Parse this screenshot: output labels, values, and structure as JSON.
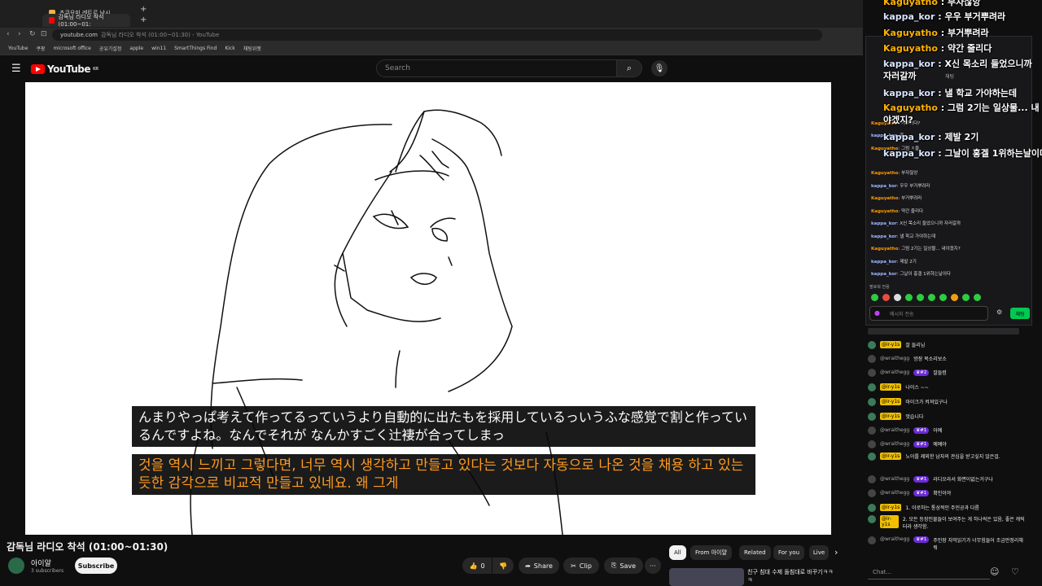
{
  "browser": {
    "tabs": [
      {
        "label": "츠쿠요미 레트로 낚시"
      },
      {
        "label": "감독님 라디오 착석 (01:00~01:"
      }
    ],
    "new_tab": "+",
    "url_domain": "youtube.com",
    "url_title": "감독님 라디오 착석 (01:00~01:30) - YouTube",
    "bookmarks": [
      "YouTube",
      "쿠팡",
      "microsoft office",
      "공유기설정",
      "apple",
      "win11",
      "SmartThings Find",
      "Kick",
      "채팅위젯"
    ]
  },
  "youtube": {
    "logo": "YouTube",
    "logo_region": "KR",
    "search_placeholder": "Search"
  },
  "video": {
    "subtitle_jp": "んまりやっぱ考えて作ってるっていうより自動的に出たもを採用しているっいうふな感覚で割と作っているんですよね。なんでそれが なんかすごく辻褄が合ってしまっ",
    "subtitle_ko": "것을 역시 느끼고 그렇다면, 너무 역시 생각하고 만들고 있다는 것보다 자동으로 나온 것을 채용 하고 있는 듯한 감각으로 비교적 만들고 있네요. 왜 그게"
  },
  "info": {
    "title": "감독님 라디오 착석 (01:00~01:30)",
    "channel": "아이얄",
    "subscribers": "3 subscribers",
    "subscribe": "Subscribe",
    "like_count": "0",
    "share": "Share",
    "clip": "Clip",
    "save": "Save",
    "more": "···"
  },
  "chips": [
    "All",
    "From 아이얄",
    "Related",
    "For you",
    "Live"
  ],
  "related": {
    "title": "친구 침대 수제 돌침대로 바꾸기ㅋㅋㅋ"
  },
  "overlay_chat": [
    {
      "user": "Kaguyatho",
      "text": "부자잖앙",
      "kind": "k"
    },
    {
      "user": "kappa_kor",
      "text": "우우 부거뿌려라",
      "kind": "b"
    },
    {
      "user": "Kaguyatho",
      "text": "부거뿌려라",
      "kind": "k"
    },
    {
      "user": "Kaguyatho",
      "text": "약간 줄리다",
      "kind": "k"
    },
    {
      "user": "kappa_kor",
      "text": "X신 목소리 들었으니까 자러갈까",
      "kind": "b"
    },
    {
      "user": "kappa_kor",
      "text": "낼 학교 가야하는데",
      "kind": "b"
    },
    {
      "user": "Kaguyatho",
      "text": "그럼 2기는 일상물... 내야겠지?",
      "kind": "k"
    },
    {
      "user": "kappa_kor",
      "text": "제발 2기",
      "kind": "b"
    },
    {
      "user": "kappa_kor",
      "text": "그날이 홍겔 1위하는날이다",
      "kind": "b"
    }
  ],
  "chat_window": {
    "title": "채팅",
    "messages": [
      {
        "user": "Kaguyatho",
        "text": "카루이다?",
        "kind": "k"
      },
      {
        "user": "kappa_kor",
        "text": "홍",
        "kind": "b"
      },
      {
        "user": "Kaguyatho",
        "text": "그럼 ㅈ을",
        "kind": "k"
      },
      {
        "user": "Kaguyatho",
        "text": "부자잖앙",
        "kind": "k"
      },
      {
        "user": "kappa_kor",
        "text": "우우 부거뿌려라",
        "kind": "b"
      },
      {
        "user": "Kaguyatho",
        "text": "부거뿌려라",
        "kind": "k"
      },
      {
        "user": "Kaguyatho",
        "text": "약간 줄리다",
        "kind": "k"
      },
      {
        "user": "kappa_kor",
        "text": "X신 목소리 들었으니까 자러갈까",
        "kind": "b"
      },
      {
        "user": "kappa_kor",
        "text": "낼 학교 가야하는데",
        "kind": "b"
      },
      {
        "user": "Kaguyatho",
        "text": "그럼 2기는 일상물... 내야겠지?",
        "kind": "k"
      },
      {
        "user": "kappa_kor",
        "text": "제발 2기",
        "kind": "b"
      },
      {
        "user": "kappa_kor",
        "text": "그날이 홍겔 1위하는날이다",
        "kind": "b"
      }
    ],
    "follow_label": "팔로워 전용",
    "input_placeholder": "메시지 전송",
    "send": "채팅"
  },
  "live_chat": {
    "messages": [
      {
        "user": "@ir-y1s",
        "badge": "",
        "text": "잘 들리님",
        "y": true
      },
      {
        "user": "@wraithegg",
        "badge": "",
        "text": "방장 목소리보소",
        "y": false
      },
      {
        "user": "@wraithegg",
        "badge": "#2",
        "text": "잘들렴",
        "y": false
      },
      {
        "user": "@ir-y1s",
        "badge": "",
        "text": "나이스 ~~",
        "y": true
      },
      {
        "user": "@ir-y1s",
        "badge": "",
        "text": "마이크가 켜져있구나",
        "y": true
      },
      {
        "user": "@ir-y1s",
        "badge": "",
        "text": "멋습니다",
        "y": true
      },
      {
        "user": "@wraithegg",
        "badge": "#1",
        "text": "아예",
        "y": false
      },
      {
        "user": "@wraithegg",
        "badge": "#1",
        "text": "예예야",
        "y": false
      },
      {
        "user": "@ir-y1s",
        "badge": "",
        "text": "노이를 제외한 남자의 관심을 받고싶지 않은걸.",
        "y": true
      },
      {
        "user": "@wraithegg",
        "badge": "#1",
        "text": "라디오라서 화면이없는거구나",
        "y": false
      },
      {
        "user": "@wraithegg",
        "badge": "#1",
        "text": "확인이야",
        "y": false
      },
      {
        "user": "@ir-y1s",
        "badge": "",
        "text": "1. 이로하는 통상적인 주인공과 다름",
        "y": true
      },
      {
        "user": "@ir-y1s",
        "badge": "",
        "text": "2. 모든 등장인물들이 보여주는 게 하나씩은 있음, 좋은 캐릭터라 생각함.",
        "y": true
      },
      {
        "user": "@wraithegg",
        "badge": "#1",
        "text": "주인장 자막읽기가 너무힘들어 조금만정리해줘",
        "y": false
      }
    ],
    "input_placeholder": "Chat..."
  }
}
